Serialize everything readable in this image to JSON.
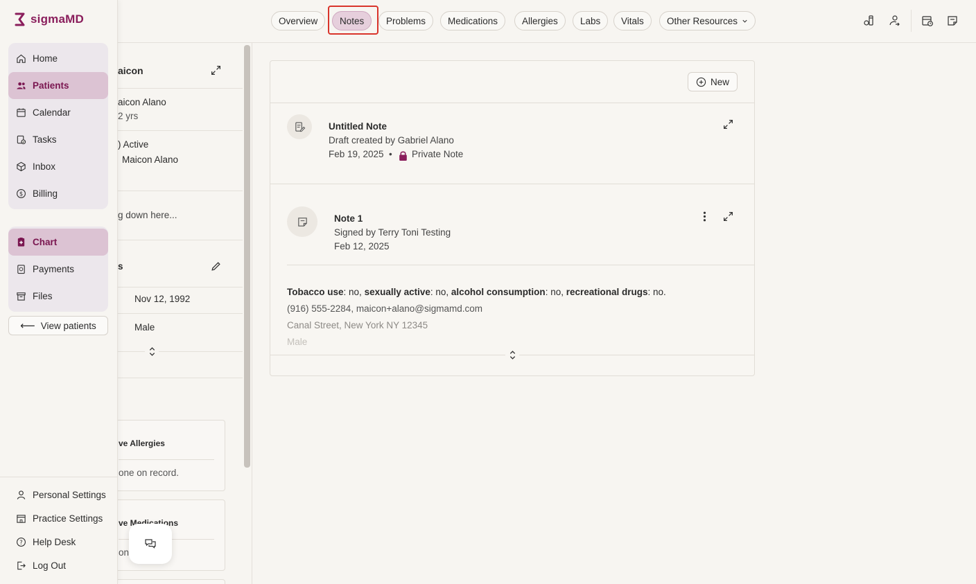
{
  "brand": {
    "name": "sigmaMD",
    "color": "#8a1e5c"
  },
  "nav": {
    "main": [
      {
        "label": "Home",
        "icon": "home-icon",
        "active": false
      },
      {
        "label": "Patients",
        "icon": "users-icon",
        "active": true
      },
      {
        "label": "Calendar",
        "icon": "calendar-icon",
        "active": false
      },
      {
        "label": "Tasks",
        "icon": "tasks-icon",
        "active": false
      },
      {
        "label": "Inbox",
        "icon": "inbox-icon",
        "active": false
      },
      {
        "label": "Billing",
        "icon": "dollar-icon",
        "active": false
      }
    ],
    "patient": [
      {
        "label": "Chart",
        "icon": "chart-icon",
        "active": true
      },
      {
        "label": "Payments",
        "icon": "payments-icon",
        "active": false
      },
      {
        "label": "Files",
        "icon": "files-icon",
        "active": false
      }
    ],
    "view_patients": "View patients",
    "bottom": [
      {
        "label": "Personal Settings",
        "icon": "user-icon"
      },
      {
        "label": "Practice Settings",
        "icon": "building-icon"
      },
      {
        "label": "Help Desk",
        "icon": "help-icon"
      },
      {
        "label": "Log Out",
        "icon": "logout-icon"
      }
    ]
  },
  "patient_col": {
    "name_partial": "aicon",
    "full_name_partial": "aicon Alano",
    "age_partial": "2 yrs",
    "status_partial": ") Active",
    "provider_partial": "Maicon Alano",
    "notes_placeholder_partial": "g down here...",
    "section_partial": "s",
    "dob": "Nov 12, 1992",
    "sex": "Male",
    "allergies_title_partial": "ve Allergies",
    "allergies_body_partial": "one on record.",
    "medications_title_partial": "ve Medications",
    "medications_body_partial": "one",
    "medications_body_partial2": "d."
  },
  "tabs": [
    {
      "label": "Overview",
      "active": false
    },
    {
      "label": "Notes",
      "active": true
    },
    {
      "label": "Problems",
      "active": false
    },
    {
      "label": "Medications",
      "active": false
    },
    {
      "label": "Allergies",
      "active": false
    },
    {
      "label": "Labs",
      "active": false
    },
    {
      "label": "Vitals",
      "active": false
    },
    {
      "label": "Other Resources",
      "active": false
    }
  ],
  "toolbar_icons": [
    "lab-order-icon",
    "referral-icon",
    "schedule-icon",
    "note-icon"
  ],
  "notes": {
    "new_label": "New",
    "items": [
      {
        "title": "Untitled Note",
        "subtitle": "Draft created by Gabriel Alano",
        "date": "Feb 19, 2025",
        "separator": "•",
        "privacy": "Private Note"
      },
      {
        "title": "Note 1",
        "subtitle": "Signed by Terry Toni Testing",
        "date": "Feb 12, 2025"
      }
    ],
    "content": {
      "habits": [
        {
          "label": "Tobacco use",
          "value": ": no, "
        },
        {
          "label": "sexually active",
          "value": ": no, "
        },
        {
          "label": "alcohol consumption",
          "value": ": no, "
        },
        {
          "label": "recreational drugs",
          "value": ": no."
        }
      ],
      "contact": "(916) 555-2284, maicon+alano@sigmamd.com",
      "address": "Canal Street, New York NY 12345",
      "sex": "Male"
    }
  }
}
